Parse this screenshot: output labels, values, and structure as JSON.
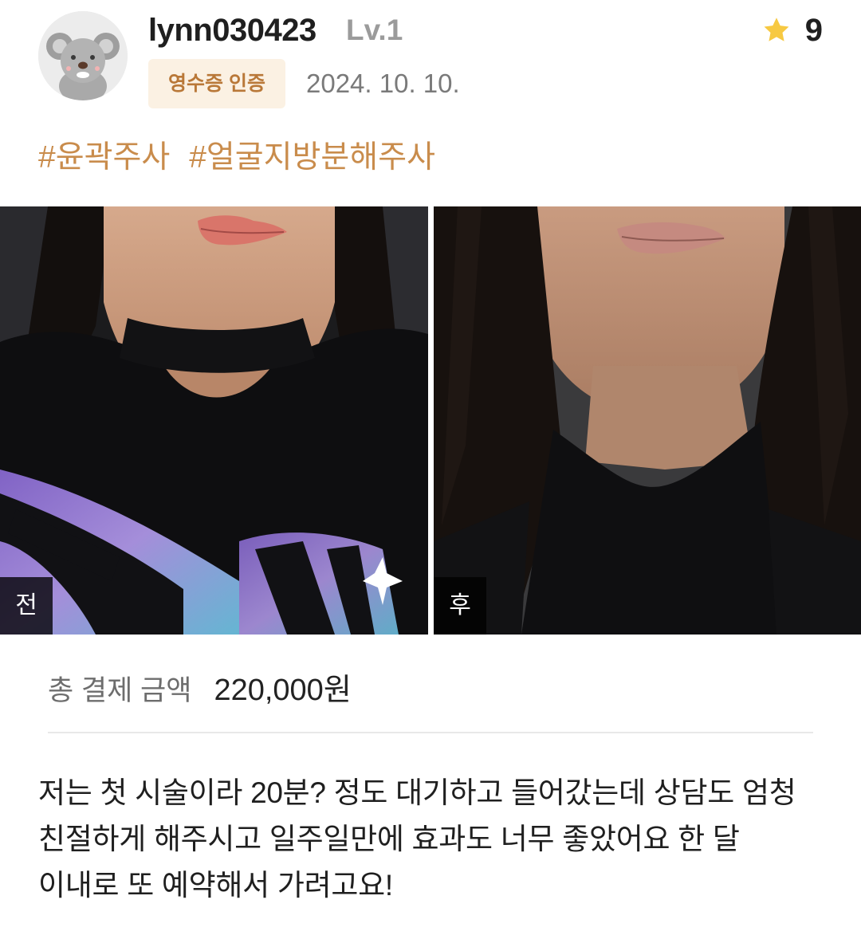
{
  "review": {
    "author": {
      "username": "lynn030423",
      "level": "Lv.1",
      "avatar_icon": "koala-avatar-icon"
    },
    "receipt_badge": "영수증 인증",
    "date": "2024. 10. 10.",
    "rating": {
      "icon": "star-icon",
      "value": "9",
      "star_color": "#f7c942"
    },
    "tags": [
      "#윤곽주사",
      "#얼굴지방분해주사"
    ],
    "photos": [
      {
        "label": "전"
      },
      {
        "label": "후"
      }
    ],
    "payment": {
      "label": "총 결제 금액",
      "amount": "220,000원"
    },
    "body": "저는 첫 시술이라 20분? 정도 대기하고 들어갔는데 상담도 엄청 친절하게 해주시고 일주일만에 효과도 너무 좋았어요 한 달 이내로 또 예약해서 가려고요!"
  },
  "colors": {
    "accent": "#c98c4c",
    "badge_bg": "#fbf1e3",
    "badge_text": "#b97838"
  }
}
